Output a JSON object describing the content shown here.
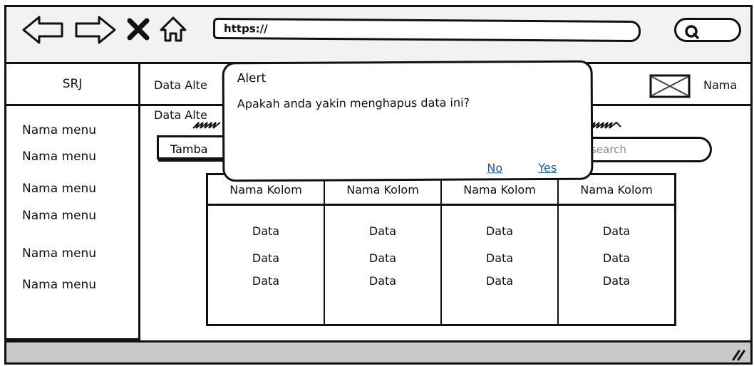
{
  "browser": {
    "url": "https://",
    "icons": [
      "back-arrow-icon",
      "forward-arrow-icon",
      "close-icon",
      "home-icon",
      "search-icon"
    ]
  },
  "app": {
    "brand": "SRJ"
  },
  "sidebar": {
    "items": [
      {
        "label": "Nama menu"
      },
      {
        "label": "Nama menu"
      },
      {
        "label": "Nama menu"
      },
      {
        "label": "Nama menu"
      },
      {
        "label": "Nama menu"
      },
      {
        "label": "Nama menu"
      }
    ]
  },
  "header": {
    "title": "Data Alte",
    "profile_name": "Nama"
  },
  "content": {
    "breadcrumb": "Data Alte",
    "add_button": "Tamba",
    "search_placeholder": "search"
  },
  "table": {
    "columns": [
      "Nama Kolom",
      "Nama Kolom",
      "Nama Kolom",
      "Nama Kolom"
    ],
    "rows": [
      [
        "Data",
        "Data",
        "Data",
        "Data"
      ],
      [
        "Data",
        "Data",
        "Data",
        "Data"
      ],
      [
        "Data",
        "Data",
        "Data",
        "Data"
      ]
    ]
  },
  "dialog": {
    "title": "Alert",
    "message": "Apakah anda yakin menghapus data ini?",
    "no_label": "No",
    "yes_label": "Yes"
  },
  "colors": {
    "link": "#1a5aa6",
    "toolbar": "#f2f2f2",
    "statusbar": "#c8c8c8"
  }
}
